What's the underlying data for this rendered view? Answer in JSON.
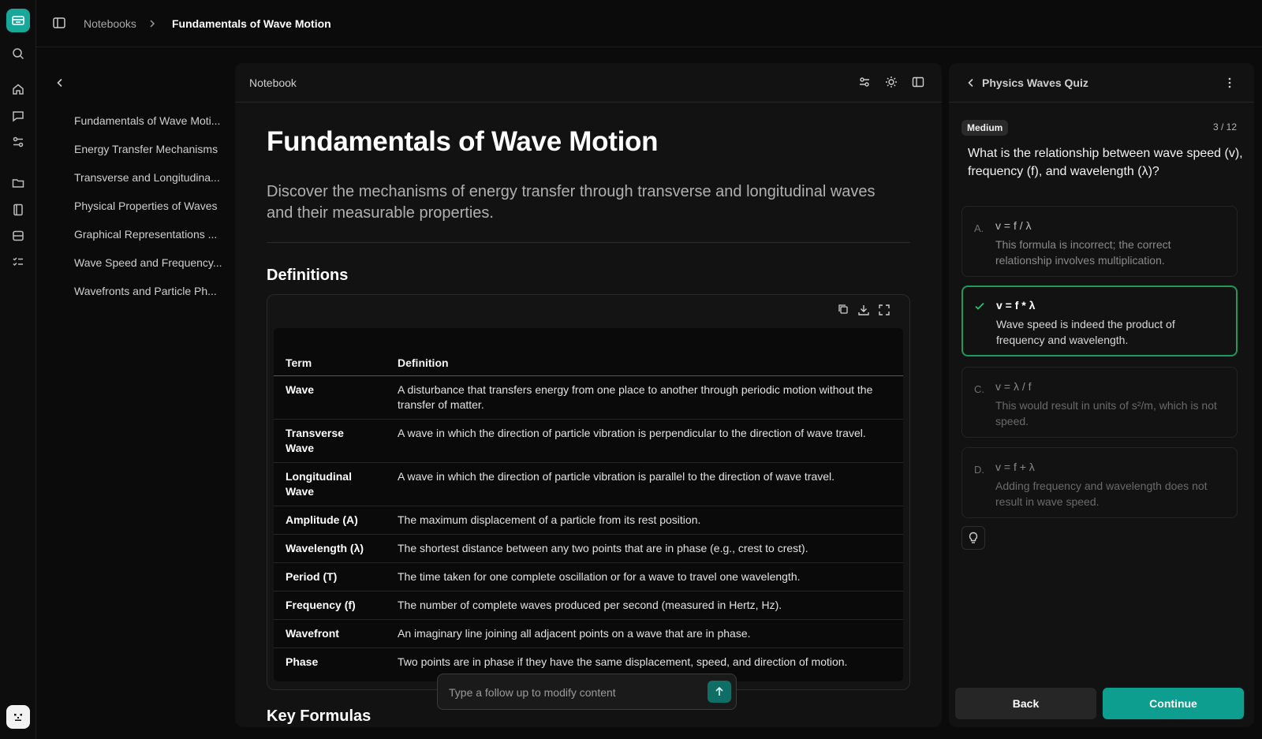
{
  "breadcrumb": {
    "root": "Notebooks",
    "current": "Fundamentals of Wave Motion"
  },
  "outline": {
    "items": [
      "Fundamentals of Wave Moti...",
      "Energy Transfer Mechanisms",
      "Transverse and Longitudina...",
      "Physical Properties of Waves",
      "Graphical Representations ...",
      "Wave Speed and Frequency...",
      "Wavefronts and Particle Ph..."
    ]
  },
  "notebook": {
    "header_title": "Notebook",
    "title": "Fundamentals of Wave Motion",
    "subtitle": "Discover the mechanisms of energy transfer through transverse and longitudinal waves and their measurable properties.",
    "section_definitions": "Definitions",
    "section_next": "Key Formulas",
    "table": {
      "headers": [
        "Term",
        "Definition"
      ],
      "rows": [
        [
          "Wave",
          "A disturbance that transfers energy from one place to another through periodic motion without the transfer of matter."
        ],
        [
          "Transverse Wave",
          "A wave in which the direction of particle vibration is perpendicular to the direction of wave travel."
        ],
        [
          "Longitudinal Wave",
          "A wave in which the direction of particle vibration is parallel to the direction of wave travel."
        ],
        [
          "Amplitude (A)",
          "The maximum displacement of a particle from its rest position."
        ],
        [
          "Wavelength (λ)",
          "The shortest distance between any two points that are in phase (e.g., crest to crest)."
        ],
        [
          "Period (T)",
          "The time taken for one complete oscillation or for a wave to travel one wavelength."
        ],
        [
          "Frequency (f)",
          "The number of complete waves produced per second (measured in Hertz, Hz)."
        ],
        [
          "Wavefront",
          "An imaginary line joining all adjacent points on a wave that are in phase."
        ],
        [
          "Phase",
          "Two points are in phase if they have the same displacement, speed, and direction of motion."
        ]
      ]
    },
    "followup_placeholder": "Type a follow up to modify content"
  },
  "quiz": {
    "title": "Physics Waves Quiz",
    "difficulty": "Medium",
    "counter": "3 / 12",
    "question": "What is the relationship between wave speed (v), frequency (f), and wavelength (λ)?",
    "options": [
      {
        "letter": "A.",
        "formula": "v = f / λ",
        "explanation": "This formula is incorrect; the correct relationship involves multiplication."
      },
      {
        "letter": "B.",
        "formula": "v = f * λ",
        "explanation": "Wave speed is indeed the product of frequency and wavelength."
      },
      {
        "letter": "C.",
        "formula": "v = λ / f",
        "explanation": "This would result in units of s²/m, which is not speed."
      },
      {
        "letter": "D.",
        "formula": "v = f + λ",
        "explanation": "Adding frequency and wavelength does not result in wave speed."
      }
    ],
    "back_label": "Back",
    "continue_label": "Continue"
  },
  "colors": {
    "accent": "#0e9e8f",
    "correct": "#1f9a5a",
    "background": "#0b0b0b",
    "panel": "#121212"
  },
  "icons": {
    "rail": [
      "home-icon",
      "search-icon",
      "chat-icon",
      "settings-sliders-icon",
      "folder-icon",
      "notebook-icon",
      "storage-icon",
      "checklist-icon"
    ]
  }
}
